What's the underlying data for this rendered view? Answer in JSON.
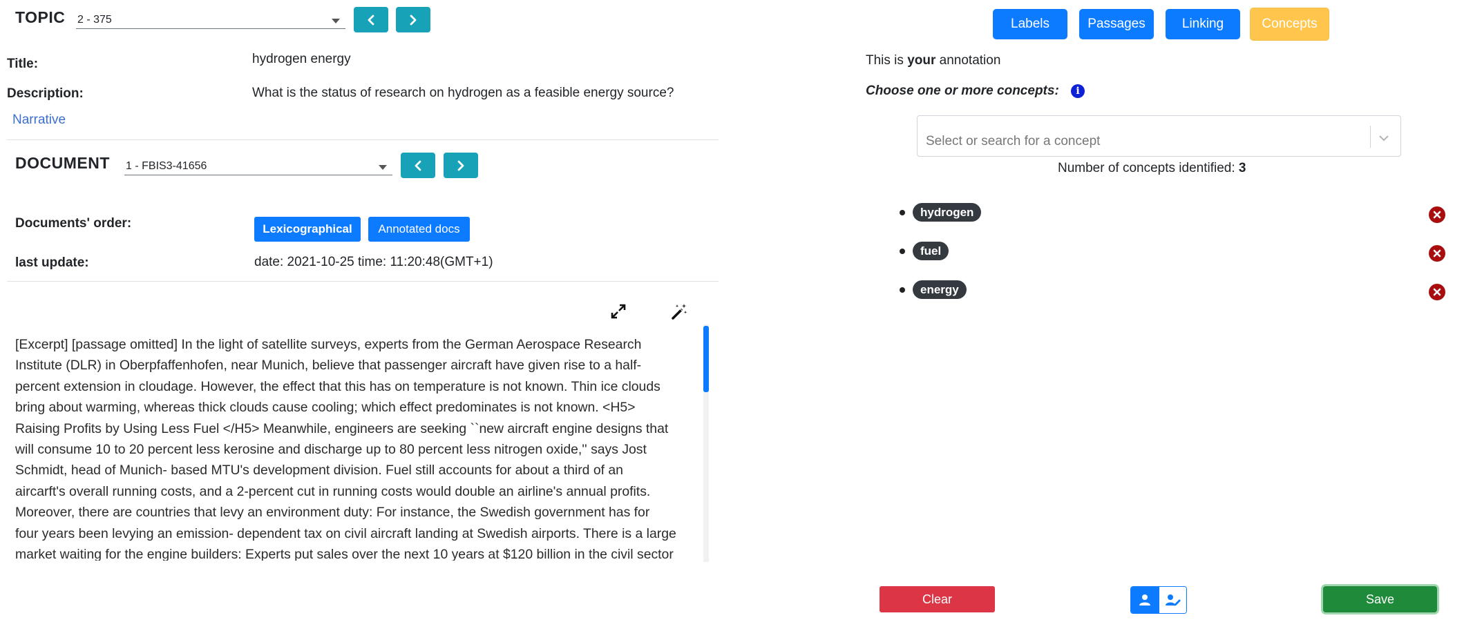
{
  "topic": {
    "label": "TOPIC",
    "selected": "2 - 375",
    "title_label": "Title:",
    "title_value": "hydrogen energy",
    "description_label": "Description:",
    "description_value": "What is the status of research on hydrogen as a feasible energy source?",
    "narrative_link": "Narrative"
  },
  "document": {
    "label": "DOCUMENT",
    "selected": "1 - FBIS3-41656",
    "order_label": "Documents' order:",
    "order_options": [
      "Lexicographical",
      "Annotated docs"
    ],
    "last_update_label": "last update:",
    "last_update_value": "date: 2021-10-25 time: 11:20:48(GMT+1)",
    "text_lines": [
      "[Excerpt] [passage omitted] In the light of satellite surveys, experts from the German Aerospace Research",
      "Institute (DLR) in Oberpfaffenhofen, near Munich, believe that passenger aircraft have given rise to a half-",
      "percent extension in cloudage. However, the effect that this has on temperature is not known. Thin ice clouds",
      "bring about warming, whereas thick clouds cause cooling; which effect predominates is not known. <H5>",
      "Raising Profits by Using Less Fuel </H5> Meanwhile, engineers are seeking ``new aircraft engine designs that",
      "will consume 10 to 20 percent less kerosine and discharge up to 80 percent less nitrogen oxide,'' says Jost",
      "Schmidt, head of Munich- based MTU's development division. Fuel still accounts for about a third of an",
      "aircarft's overall running costs, and a 2-percent cut in running costs would double an airline's annual profits.",
      "Moreover, there are countries that levy an environment duty: For instance, the Swedish government has for",
      "four years been levying an emission- dependent tax on civil aircraft landing at Swedish airports. There is a large",
      "market waiting for the engine builders: Experts put sales over the next 10 years at $120 billion in the civil sector"
    ]
  },
  "tabs": [
    "Labels",
    "Passages",
    "Linking",
    "Concepts"
  ],
  "active_tab": "Concepts",
  "annotation": {
    "owner_prefix": "This is ",
    "owner_bold": "your",
    "owner_suffix": " annotation",
    "prompt": "Choose one or more concepts:",
    "search_placeholder": "Select or search for a concept",
    "count_label": "Number of concepts identified: ",
    "count_value": "3",
    "concepts": [
      "hydrogen",
      "fuel",
      "energy"
    ]
  },
  "actions": {
    "clear": "Clear",
    "save": "Save"
  },
  "colors": {
    "primary": "#0d7bff",
    "teal": "#17a2b8",
    "active_tab": "#ffc54d",
    "danger": "#dc3545",
    "success": "#1e8a3a"
  }
}
